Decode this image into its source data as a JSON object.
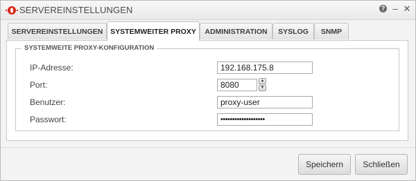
{
  "window": {
    "title": "SERVEREINSTELLUNGEN",
    "logo_icon": "brand-logo-icon",
    "controls": [
      "help-icon",
      "minimize-icon",
      "close-icon"
    ],
    "help_glyph": "?",
    "minimize_glyph": "–",
    "close_glyph": "✕"
  },
  "tabs": [
    {
      "label": "SERVEREINSTELLUNGEN",
      "active": false
    },
    {
      "label": "SYSTEMWEITER PROXY",
      "active": true
    },
    {
      "label": "ADMINISTRATION",
      "active": false
    },
    {
      "label": "SYSLOG",
      "active": false
    },
    {
      "label": "SNMP",
      "active": false
    }
  ],
  "section": {
    "legend": "SYSTEMWEITE PROXY-KONFIGURATION",
    "fields": {
      "ip": {
        "label": "IP-Adresse:",
        "value": "192.168.175.8"
      },
      "port": {
        "label": "Port:",
        "value": "8080"
      },
      "user": {
        "label": "Benutzer:",
        "value": "proxy-user"
      },
      "password": {
        "label": "Passwort:",
        "value": "•••••••••••••••••••"
      }
    }
  },
  "buttons": {
    "save": "Speichern",
    "close": "Schließen"
  },
  "colors": {
    "brand_red": "#d9261c",
    "text": "#333333",
    "border": "#c6c6c6"
  }
}
